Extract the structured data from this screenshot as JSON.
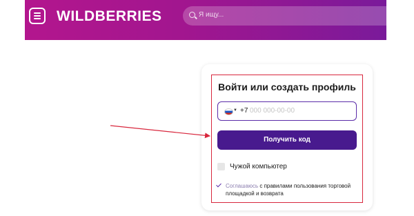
{
  "header": {
    "logo": "WILDBERRIES",
    "search_placeholder": "Я ищу...",
    "colors": {
      "gradient_start": "#b3168e",
      "gradient_end": "#7a1a9a"
    }
  },
  "login": {
    "title": "Войти или создать профиль",
    "country_code": "+7",
    "phone_placeholder": "000 000-00-00",
    "submit_label": "Получить код",
    "foreign_computer_label": "Чужой компьютер",
    "agreement_prefix": "Соглашаюсь",
    "agreement_text": " с правилами пользования торговой площадкой и возврата",
    "colors": {
      "button": "#481a8e",
      "input_border": "#5a2aa8"
    }
  },
  "annotation": {
    "highlight_color": "#d8263c"
  }
}
